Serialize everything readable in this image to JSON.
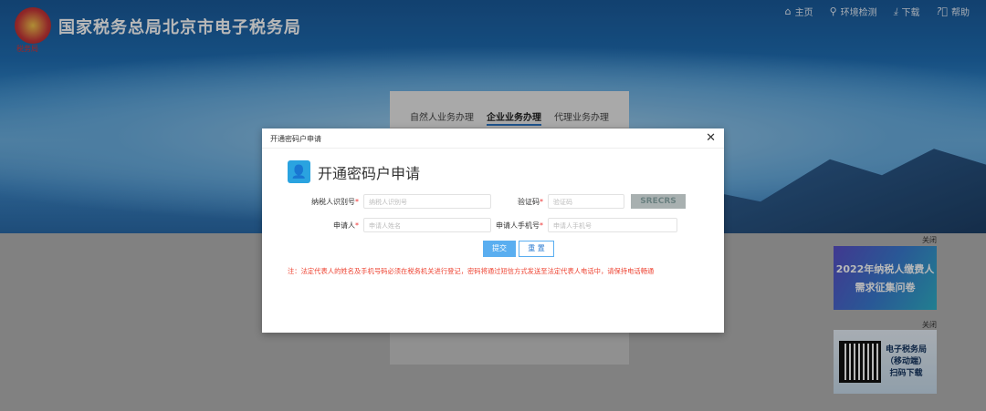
{
  "header": {
    "title": "国家税务总局北京市电子税务局",
    "logo_text": "税务局",
    "nav": [
      {
        "icon": "home-icon",
        "label": "主页"
      },
      {
        "icon": "search-icon",
        "label": "环境检测"
      },
      {
        "icon": "download-icon",
        "label": "下载"
      },
      {
        "icon": "help-icon",
        "label": "帮助"
      }
    ]
  },
  "tabs": [
    "自然人业务办理",
    "企业业务办理",
    "代理业务办理"
  ],
  "side": {
    "close1": "关闭",
    "banner1_line1": "2022年纳税人缴费人",
    "banner1_line2": "需求征集问卷",
    "close2": "关闭",
    "banner2_line1": "电子税务局",
    "banner2_line2": "（移动端）",
    "banner2_line3": "扫码下载"
  },
  "modal": {
    "header": "开通密码户申请",
    "title": "开通密码户申请",
    "fields": {
      "taxpayer_id": {
        "label": "纳税人识别号",
        "placeholder": "纳税人识别号"
      },
      "captcha": {
        "label": "验证码",
        "placeholder": "验证码",
        "image_text": "SRECRS"
      },
      "applicant": {
        "label": "申请人",
        "placeholder": "申请人姓名"
      },
      "phone": {
        "label": "申请人手机号",
        "placeholder": "申请人手机号"
      }
    },
    "required_mark": "*",
    "submit": "提交",
    "reset": "重 置",
    "note": "注：法定代表人的姓名及手机号码必须在税务机关进行登记，密码将通过短信方式发送至法定代表人电话中，请保持电话畅通"
  }
}
